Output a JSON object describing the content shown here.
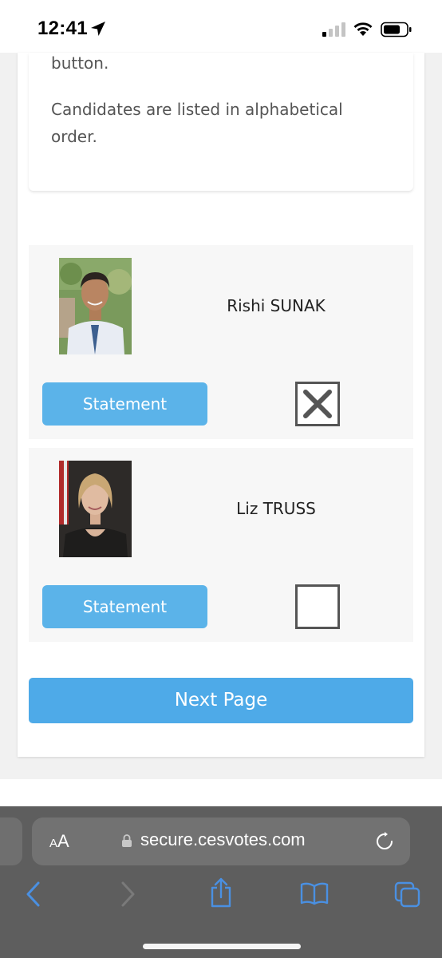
{
  "status_bar": {
    "time": "12:41"
  },
  "info": {
    "line_top": "button.",
    "paragraph": "Candidates are listed in alphabetical order."
  },
  "candidates": [
    {
      "name": "Rishi SUNAK",
      "statement_label": "Statement",
      "selected": true
    },
    {
      "name": "Liz TRUSS",
      "statement_label": "Statement",
      "selected": false
    }
  ],
  "next_button": {
    "label": "Next Page"
  },
  "browser": {
    "aa_small": "A",
    "aa_big": "A",
    "url": "secure.cesvotes.com"
  },
  "colors": {
    "button_blue": "#5bb3e9",
    "next_blue": "#4eaae8",
    "toolbar_icon_blue": "#4a90e2"
  },
  "icons": {
    "location": "location-arrow-icon",
    "signal": "cellular-signal-icon",
    "wifi": "wifi-icon",
    "battery": "battery-icon",
    "lock": "lock-icon",
    "reload": "reload-icon",
    "back": "chevron-left-icon",
    "forward": "chevron-right-icon",
    "share": "share-icon",
    "bookmarks": "book-icon",
    "tabs": "tabs-icon",
    "vote_mark": "cross-mark-icon"
  }
}
